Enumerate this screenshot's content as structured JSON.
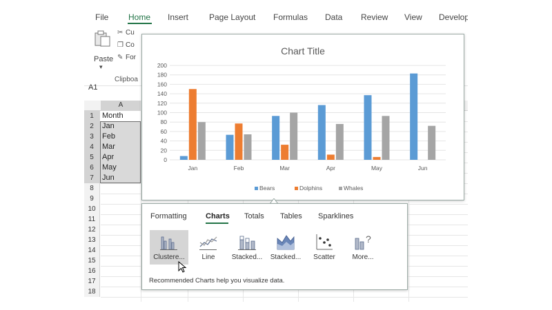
{
  "ribbon": {
    "tabs": [
      {
        "label": "File",
        "active": false
      },
      {
        "label": "Home",
        "active": true
      },
      {
        "label": "Insert",
        "active": false
      },
      {
        "label": "Page Layout",
        "active": false
      },
      {
        "label": "Formulas",
        "active": false
      },
      {
        "label": "Data",
        "active": false
      },
      {
        "label": "Review",
        "active": false
      },
      {
        "label": "View",
        "active": false
      },
      {
        "label": "Develop",
        "active": false
      }
    ],
    "clipboard": {
      "paste_label": "Paste",
      "cut_label": "Cu",
      "copy_label": "Co",
      "format_label": "For",
      "group_label": "Clipboa"
    }
  },
  "name_box": "A1",
  "sheet": {
    "column_header": "A",
    "row_numbers": [
      "1",
      "2",
      "3",
      "4",
      "5",
      "6",
      "7",
      "8",
      "9",
      "10",
      "11",
      "12",
      "13",
      "14",
      "15",
      "16",
      "17",
      "18"
    ],
    "cells": [
      "Month",
      "Jan",
      "Feb",
      "Mar",
      "Apr",
      "May",
      "Jun"
    ]
  },
  "chart_data": {
    "type": "bar",
    "title": "Chart Title",
    "categories": [
      "Jan",
      "Feb",
      "Mar",
      "Apr",
      "May",
      "Jun"
    ],
    "series": [
      {
        "name": "Bears",
        "color": "#5b9bd5",
        "values": [
          8,
          53,
          93,
          116,
          137,
          183
        ]
      },
      {
        "name": "Dolphins",
        "color": "#ed7d31",
        "values": [
          150,
          77,
          32,
          11,
          6,
          0
        ]
      },
      {
        "name": "Whales",
        "color": "#a5a5a5",
        "values": [
          80,
          54,
          100,
          76,
          93,
          72
        ]
      }
    ],
    "ylim": [
      0,
      200
    ],
    "yticks": [
      0,
      20,
      40,
      60,
      80,
      100,
      120,
      140,
      160,
      180,
      200
    ],
    "grid": true,
    "legend_position": "bottom"
  },
  "quick_analysis": {
    "tabs": [
      {
        "label": "Formatting",
        "active": false
      },
      {
        "label": "Charts",
        "active": true
      },
      {
        "label": "Totals",
        "active": false
      },
      {
        "label": "Tables",
        "active": false
      },
      {
        "label": "Sparklines",
        "active": false
      }
    ],
    "items": [
      {
        "label": "Clustere...",
        "icon": "clustered-column-icon",
        "active": true
      },
      {
        "label": "Line",
        "icon": "line-chart-icon",
        "active": false
      },
      {
        "label": "Stacked...",
        "icon": "stacked-column-icon",
        "active": false
      },
      {
        "label": "Stacked...",
        "icon": "stacked-area-icon",
        "active": false
      },
      {
        "label": "Scatter",
        "icon": "scatter-chart-icon",
        "active": false
      },
      {
        "label": "More...",
        "icon": "more-charts-icon",
        "active": false
      }
    ],
    "hint": "Recommended Charts help you visualize data."
  },
  "colors": {
    "accent": "#217346",
    "selection": "#d9d9d9",
    "popup_border": "#9aa9a4"
  }
}
